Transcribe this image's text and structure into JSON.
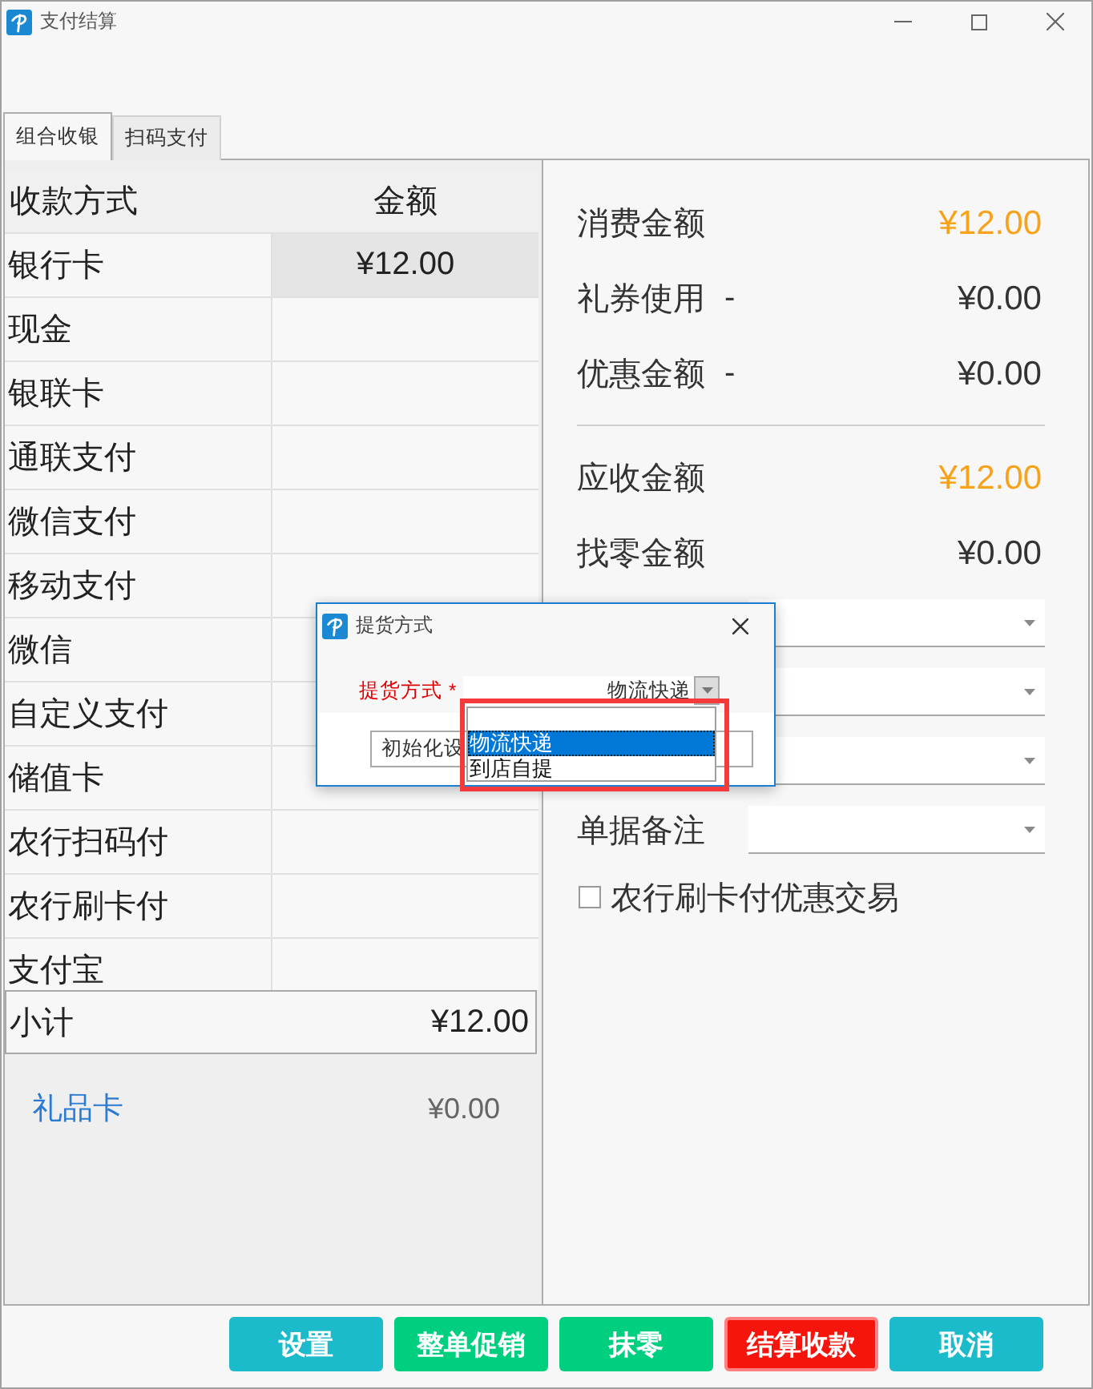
{
  "window": {
    "title": "支付结算"
  },
  "tabs": [
    {
      "label": "组合收银",
      "selected": true
    },
    {
      "label": "扫码支付",
      "selected": false
    }
  ],
  "payment_table": {
    "columns": [
      "收款方式",
      "金额"
    ],
    "rows": [
      {
        "method": "银行卡",
        "amount": "¥12.00",
        "selected": true
      },
      {
        "method": "现金",
        "selected": false
      },
      {
        "method": "银联卡",
        "selected": false
      },
      {
        "method": "通联支付",
        "selected": false
      },
      {
        "method": "微信支付",
        "selected": false
      },
      {
        "method": "移动支付",
        "selected": false
      },
      {
        "method": "微信",
        "selected": false
      },
      {
        "method": "自定义支付",
        "selected": false
      },
      {
        "method": "储值卡",
        "selected": false
      },
      {
        "method": "农行扫码付",
        "selected": false
      },
      {
        "method": "农行刷卡付",
        "selected": false
      },
      {
        "method": "支付宝",
        "selected": false
      }
    ]
  },
  "subtotal": {
    "label": "小计",
    "value": "¥12.00"
  },
  "gift_card": {
    "label": "礼品卡",
    "value": "¥0.00"
  },
  "summary": [
    {
      "label": "消费金额",
      "value": "¥12.00",
      "emphasis": true
    },
    {
      "label": "礼券使用",
      "sign": "-",
      "value": "¥0.00",
      "emphasis": false
    },
    {
      "label": "优惠金额",
      "sign": "-",
      "value": "¥0.00",
      "emphasis": false
    }
  ],
  "due": [
    {
      "label": "应收金额",
      "value": "¥12.00",
      "emphasis": true
    },
    {
      "label": "找零金额",
      "value": "¥0.00",
      "emphasis": false
    }
  ],
  "fields": [
    {
      "kind": "dropdown"
    },
    {
      "kind": "dropdown"
    },
    {
      "kind": "dropdown"
    },
    {
      "kind": "dropdown",
      "label": "单据备注"
    }
  ],
  "checkbox": {
    "label": "农行刷卡付优惠交易",
    "checked": false
  },
  "buttons": [
    {
      "label": "设置",
      "color": "#1cbbcc",
      "focused": false
    },
    {
      "label": "整单促销",
      "color": "#00cf80",
      "focused": false
    },
    {
      "label": "抹零",
      "color": "#00cf80",
      "focused": false
    },
    {
      "label": "结算收款",
      "color": "#f5150d",
      "focused": true
    },
    {
      "label": "取消",
      "color": "#1cbbcc",
      "focused": false
    }
  ],
  "dialog": {
    "title": "提货方式",
    "field": {
      "label": "提货方式",
      "marker": "*",
      "value": "物流快递",
      "expanded": true
    },
    "options": [
      {
        "label": "物流快递",
        "selected": true
      },
      {
        "label": "到店自提",
        "selected": false
      }
    ],
    "input": {
      "value": "初始化设"
    }
  }
}
